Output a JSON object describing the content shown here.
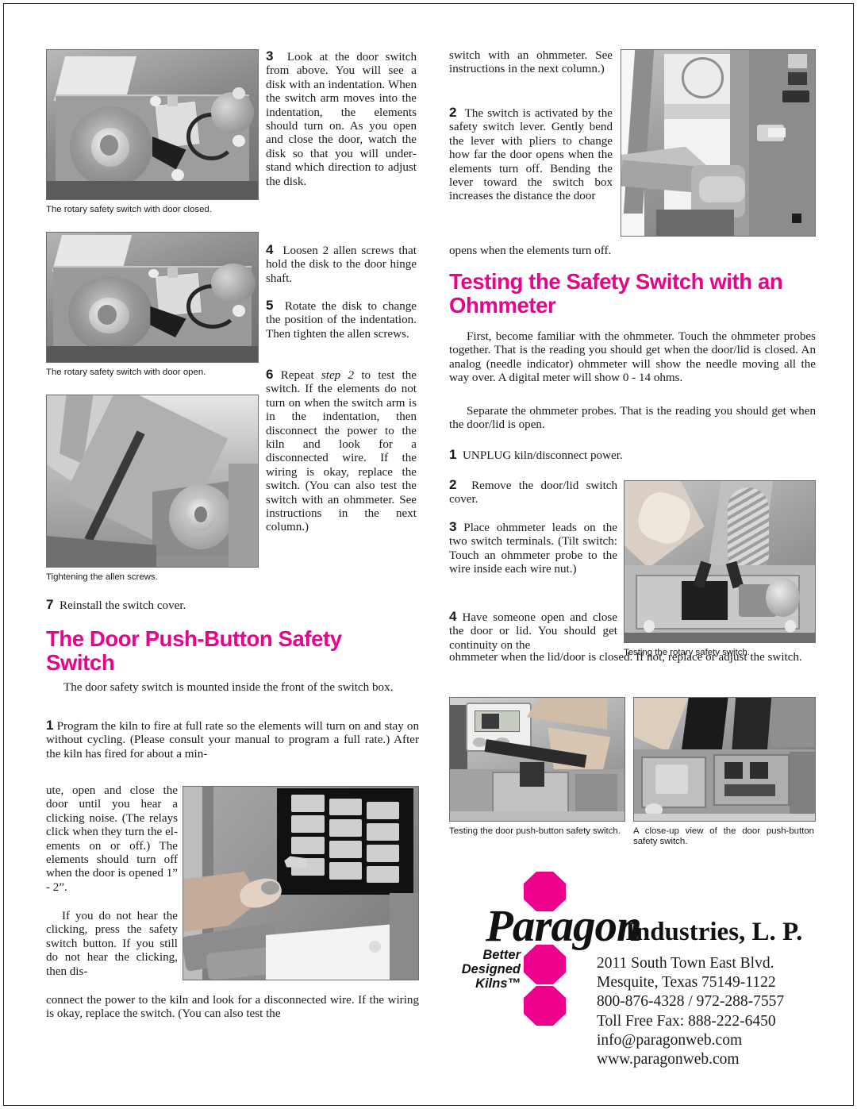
{
  "page": {
    "accent_color": "#ec008c",
    "text_color": "#1a1a1a"
  },
  "col1": {
    "step3": {
      "num": "3",
      "text": "Look at the door switch from above. You will see a disk with an in­dentation. When the switch arm moves into the indentation, the ele­ments should turn on. As you open and close the door, watch the disk so that you will under­stand which direction to adjust the disk."
    },
    "step4": {
      "num": "4",
      "text": "Loosen 2 allen screws that hold the disk to the door hinge shaft."
    },
    "step5": {
      "num": "5",
      "text": "Rotate the disk to change the position of the indentation. Then tighten the allen screws."
    },
    "step6": {
      "num": "6",
      "text_pre": "Repeat ",
      "text_ital": "step 2",
      "text_post": " to test the switch. If the ele­ments do not turn on when the switch arm is in the indentation, then disconnect the power to the kiln and look for a disconnected wire. If the wiring is okay, replace the switch. (You can also test the switch with an ohmmeter. See in­structions in the next column.)"
    },
    "step7": {
      "num": "7",
      "text": "Reinstall the switch cover."
    },
    "captions": {
      "photo1": "The rotary safety switch with door closed.",
      "photo2": "The rotary safety switch with door open.",
      "photo3": "Tightening the allen screws."
    },
    "heading_push_button": "The Door Push-Button Safety Switch",
    "intro": "The door safety switch is mounted inside the front of the switch box.",
    "pb_step1": {
      "num": "1",
      "text_wide": "Program the kiln to fire at full rate so the elements will turn on and stay on without cycling. (Please consult your manual to program a full rate.) After the kiln has fired for about a min-",
      "text_narrow": "ute, open and close the door until you hear a clicking noise. (The relays click when they turn the el­ements on or off.) The elements should turn off when the door is opened 1” - 2”.",
      "text_narrow2": "If you do not hear the clicking, press the safety switch button. If you still do not hear the clicking, then dis-",
      "text_wide2": "connect the power to the kiln and look for a disconnected wire. If the wiring is okay, replace the switch. (You can also test the"
    }
  },
  "col2": {
    "cont_top": "switch with an ohmmeter. See instructions in the next column.)",
    "step2": {
      "num": "2",
      "text_narrow": "The switch is activated by the safety switch lever. Gently bend the lever with pliers to change how far the door opens when the elements turn off. Bending the lever toward the switch box increases the distance the door",
      "text_wide": "opens when the elements turn off."
    },
    "heading_ohmmeter": "Testing the Safety Switch with an Ohmmeter",
    "para1": "First, become familiar with the ohmmeter. Touch the ohm­meter probes together. That is the reading you should get when the door/lid is closed. An analog (needle indicator) ohm­meter will show the needle moving all the way over. A digital meter will show 0 - 14 ohms.",
    "para2": "Separate the ohmmeter probes. That is the reading you should get when the door/lid is open.",
    "ohm_step1": {
      "num": "1",
      "text": "UNPLUG kiln/disconnect power."
    },
    "ohm_step2": {
      "num": "2",
      "text": "Remove the door/lid switch cover."
    },
    "ohm_step3": {
      "num": "3",
      "text": "Place ohmmeter leads on the two switch terminals. (Tilt switch: Touch an ohm­meter probe to the wire in­side each wire nut.)"
    },
    "ohm_step4": {
      "num": "4",
      "text_narrow": "Have someone open and close the door or lid. You should get continuity on the",
      "text_wide": "ohmmeter when the lid/door is closed. If not, replace or adjust the switch."
    },
    "captions": {
      "photo_rotary": "Testing the rotary safety switch.",
      "photo_pushbutton": "Testing the door push-button safety switch.",
      "photo_closeup": "A close-up view of the door push-button safety switch."
    }
  },
  "footer": {
    "logo_script": "Paragon",
    "logo_industries": "Industries, L. P.",
    "tagline_line1": "Better",
    "tagline_line2": "Designed",
    "tagline_line3": "Kilns™",
    "address": [
      "2011 South Town East Blvd.",
      "Mesquite, Texas 75149-1122",
      "800-876-4328 / 972-288-7557",
      "Toll Free Fax: 888-222-6450",
      "info@paragonweb.com",
      "www.paragonweb.com"
    ]
  }
}
